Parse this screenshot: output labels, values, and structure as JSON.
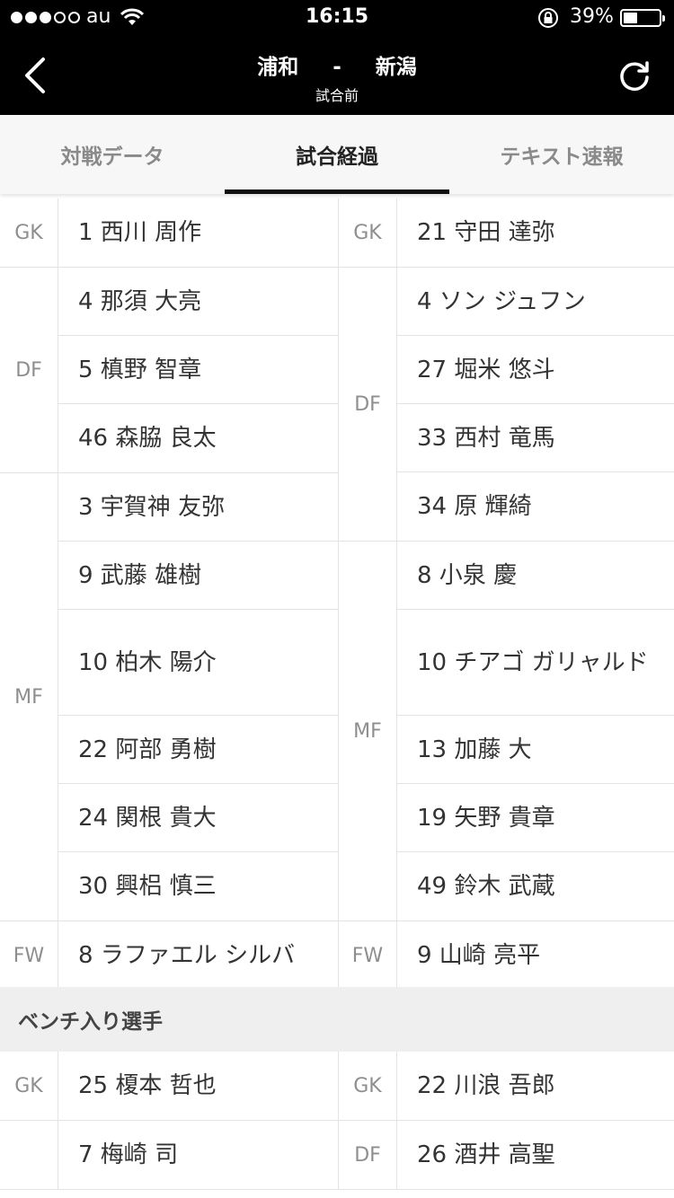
{
  "status_bar": {
    "carrier": "au",
    "time": "16:15",
    "battery_percent": "39%",
    "battery_level": 0.39,
    "signal_dots": [
      true,
      true,
      true,
      false,
      false
    ]
  },
  "nav": {
    "home_team": "浦和",
    "separator": "-",
    "away_team": "新潟",
    "phase": "試合前",
    "icons": {
      "back": "chevron-left-icon",
      "refresh": "refresh-icon"
    }
  },
  "tabs": [
    {
      "label": "対戦データ",
      "active": false
    },
    {
      "label": "試合経過",
      "active": true
    },
    {
      "label": "テキスト速報",
      "active": false
    }
  ],
  "starters": {
    "home": [
      {
        "pos": "GK",
        "players": [
          "1 西川 周作"
        ]
      },
      {
        "pos": "DF",
        "players": [
          "4 那須 大亮",
          "5 槙野 智章",
          "46 森脇 良太"
        ]
      },
      {
        "pos": "MF",
        "players": [
          "3 宇賀神 友弥",
          "9 武藤 雄樹",
          "10 柏木 陽介",
          "22 阿部 勇樹",
          "24 関根 貴大",
          "30 興梠 慎三"
        ]
      },
      {
        "pos": "FW",
        "players": [
          "8 ラファエル シルバ"
        ]
      }
    ],
    "away": [
      {
        "pos": "GK",
        "players": [
          "21 守田 達弥"
        ]
      },
      {
        "pos": "DF",
        "players": [
          "4 ソン ジュフン",
          "27 堀米 悠斗",
          "33 西村 竜馬",
          "34 原 輝綺"
        ]
      },
      {
        "pos": "MF",
        "players": [
          "8 小泉 慶",
          "10 チアゴ ガリャルド",
          "13 加藤 大",
          "19 矢野 貴章",
          "49 鈴木 武蔵"
        ]
      },
      {
        "pos": "FW",
        "players": [
          "9 山崎 亮平"
        ]
      }
    ]
  },
  "bench_title": "ベンチ入り選手",
  "bench": {
    "home": [
      {
        "pos": "GK",
        "players": [
          "25 榎本 哲也"
        ]
      },
      {
        "pos": "",
        "players": [
          "7 梅崎 司"
        ]
      }
    ],
    "away": [
      {
        "pos": "GK",
        "players": [
          "22 川浪 吾郎"
        ]
      },
      {
        "pos": "DF",
        "players": [
          "26 酒井 高聖"
        ]
      }
    ]
  }
}
